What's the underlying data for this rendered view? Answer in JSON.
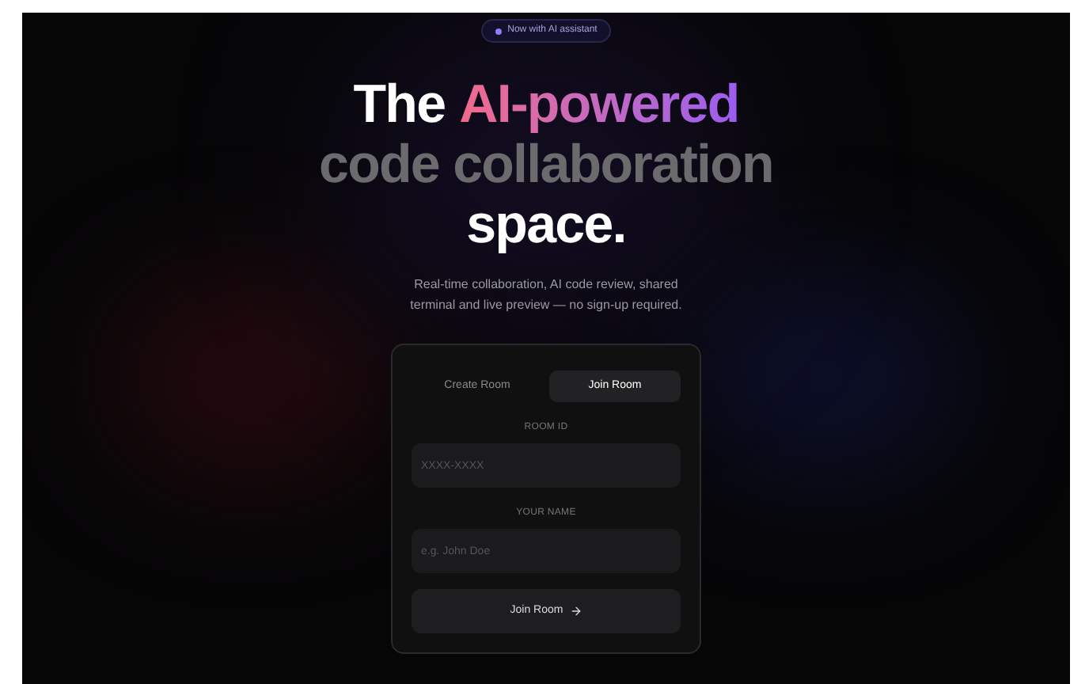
{
  "badge": {
    "text": "Now with AI assistant"
  },
  "headline": {
    "line_1_plain": "The",
    "line_1_accent": "AI-powered",
    "line_2": "code collaboration",
    "line_3": "space."
  },
  "subtitle": "Real-time collaboration, AI code review, shared terminal and live preview — no sign-up required.",
  "tabs": [
    {
      "label": "Create Room",
      "selected": false
    },
    {
      "label": "Join Room",
      "selected": true
    }
  ],
  "fields": [
    {
      "label": "ROOM ID",
      "placeholder": "XXXX-XXXX"
    },
    {
      "label": "YOUR NAME",
      "placeholder": "e.g. John Doe"
    }
  ],
  "submit": {
    "label": "Join Room"
  }
}
